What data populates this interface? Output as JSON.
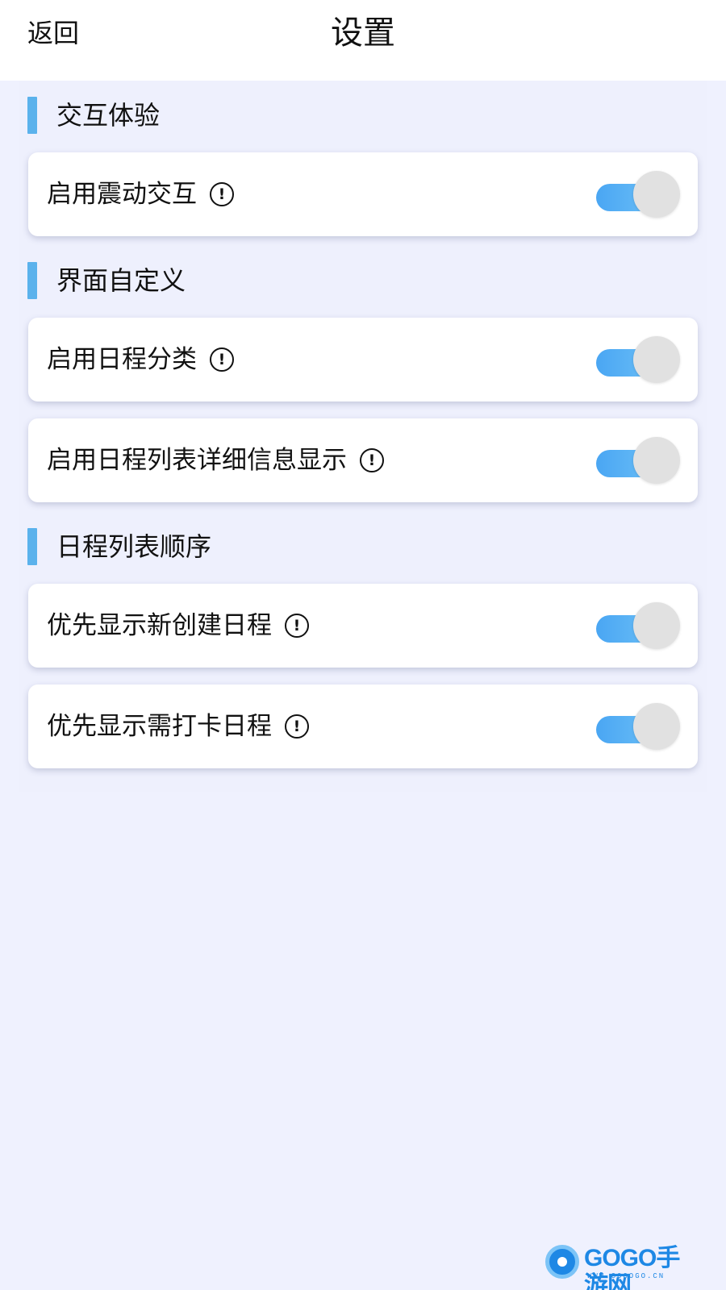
{
  "header": {
    "back_label": "返回",
    "title": "设置"
  },
  "sections": [
    {
      "title": "交互体验",
      "items": [
        {
          "label": "启用震动交互",
          "info_icon": "info-circle-icon",
          "enabled": true
        }
      ]
    },
    {
      "title": "界面自定义",
      "items": [
        {
          "label": "启用日程分类",
          "info_icon": "info-circle-icon",
          "enabled": true
        },
        {
          "label": "启用日程列表详细信息显示",
          "info_icon": "info-circle-icon",
          "enabled": true
        }
      ]
    },
    {
      "title": "日程列表顺序",
      "items": [
        {
          "label": "优先显示新创建日程",
          "info_icon": "info-circle-icon",
          "enabled": true
        },
        {
          "label": "优先显示需打卡日程",
          "info_icon": "info-circle-icon",
          "enabled": true
        }
      ]
    }
  ],
  "info_glyph": "!",
  "watermark": {
    "brand": "GOGO手游网",
    "url": "WWW.GOGOGO.CN"
  },
  "colors": {
    "accent_bar": "#5bb2ec",
    "toggle_track": "#4aa6f3",
    "toggle_knob": "#e1e1e1",
    "background": "#eff1fe"
  }
}
